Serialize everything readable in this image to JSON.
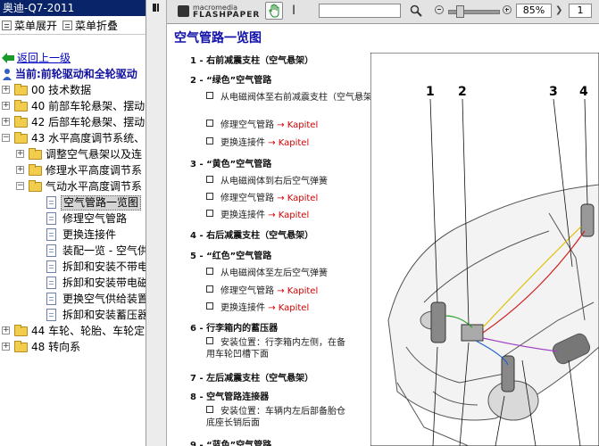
{
  "window": {
    "title": "奥迪-Q7-2011"
  },
  "left_toolbar": {
    "expand_all": "菜单展开",
    "collapse_all": "菜单折叠"
  },
  "tree": {
    "back": "返回上一级",
    "current": "当前:前轮驱动和全轮驱动",
    "items": [
      {
        "toggle": "+",
        "label": "00 技术数据"
      },
      {
        "toggle": "+",
        "label": "40 前部车轮悬架、摆动"
      },
      {
        "toggle": "+",
        "label": "42 后部车轮悬架、摆动"
      },
      {
        "toggle": "−",
        "label": "43 水平高度调节系统、"
      },
      {
        "toggle": "+",
        "label": "调整空气悬架以及连"
      },
      {
        "toggle": "+",
        "label": "修理水平高度调节系"
      },
      {
        "toggle": "−",
        "label": "气动水平高度调节系"
      },
      {
        "label": "空气管路一览图"
      },
      {
        "label": "修理空气管路"
      },
      {
        "label": "更换连接件"
      },
      {
        "label": "装配一览 - 空气供"
      },
      {
        "label": "拆卸和安装不带电"
      },
      {
        "label": "拆卸和安装带电磁"
      },
      {
        "label": "更换空气供给装置"
      },
      {
        "label": "拆卸和安装蓄压器"
      },
      {
        "toggle": "+",
        "label": "44 车轮、轮胎、车轮定"
      },
      {
        "toggle": "+",
        "label": "48 转向系"
      }
    ]
  },
  "viewer": {
    "logo_small": "macromedia",
    "logo_name": "FLASHPAPER",
    "search_value": "",
    "zoom": "85%",
    "page": "1"
  },
  "doc": {
    "title": "空气管路一览图",
    "kapitel": "→ Kapitel",
    "entries": [
      {
        "text": "1 - 右前减震支柱（空气悬架）"
      },
      {
        "text": "2 - “绿色”空气管路"
      },
      {
        "text": "从电磁阀体至右前减震支柱（空气悬架）",
        "sub": true
      },
      {
        "text": "修理空气管路",
        "sub": true,
        "kap": true
      },
      {
        "text": "更换连接件",
        "sub": true,
        "kap": true
      },
      {
        "text": "3 - “黄色”空气管路"
      },
      {
        "text": "从电磁阀体到右后空气弹簧",
        "sub": true
      },
      {
        "text": "修理空气管路",
        "sub": true,
        "kap": true
      },
      {
        "text": "更换连接件",
        "sub": true,
        "kap": true
      },
      {
        "text": "4 - 右后减震支柱（空气悬架）"
      },
      {
        "text": "5 - “红色”空气管路"
      },
      {
        "text": "从电磁阀体至左后空气弹簧",
        "sub": true
      },
      {
        "text": "修理空气管路",
        "sub": true,
        "kap": true
      },
      {
        "text": "更换连接件",
        "sub": true,
        "kap": true
      },
      {
        "text": "6 - 行李箱内的蓄压器"
      },
      {
        "text": "安装位置：行李箱内左侧，在备用车轮凹槽下面",
        "sub": true
      },
      {
        "text": "7 - 左后减震支柱（空气悬架）"
      },
      {
        "text": "8 - 空气管路连接器"
      },
      {
        "text": "安装位置：车辆内左后部备胎仓底座长销后面",
        "sub": true
      },
      {
        "text": "9 - “蓝色”空气管路"
      }
    ],
    "callouts": [
      "1",
      "2",
      "3",
      "4"
    ]
  }
}
